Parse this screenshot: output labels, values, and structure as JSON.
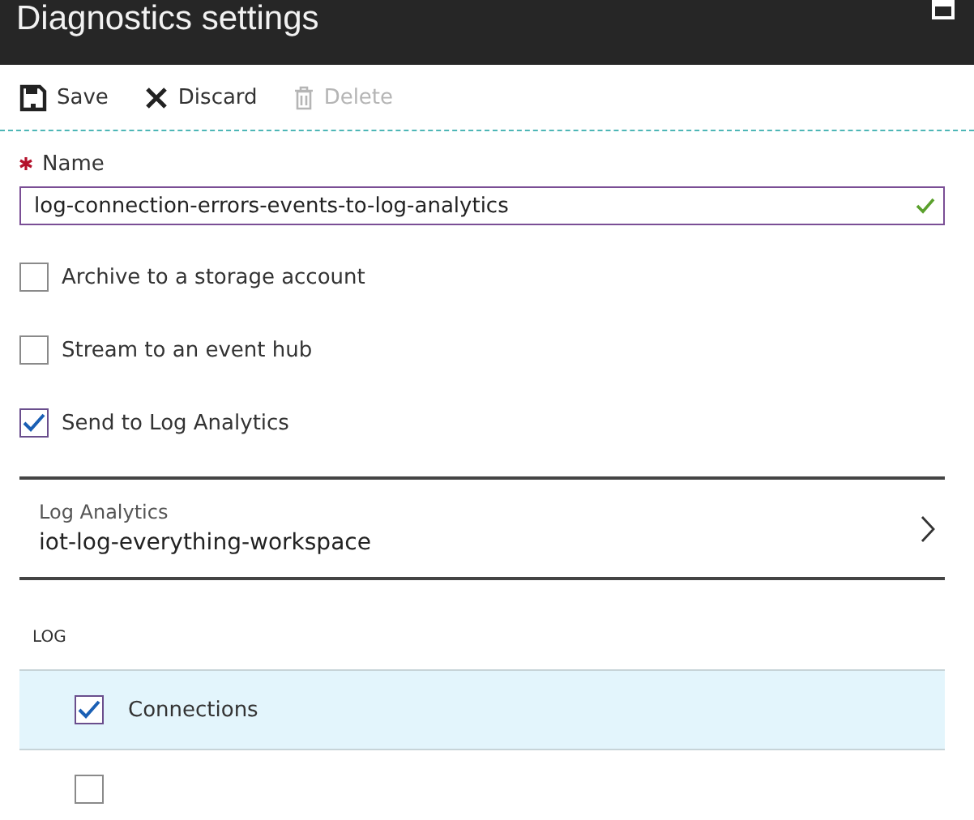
{
  "window": {
    "title": "Diagnostics settings"
  },
  "toolbar": [
    {
      "kind": "save",
      "label": "Save",
      "disabled": false
    },
    {
      "kind": "discard",
      "label": "Discard",
      "disabled": false
    },
    {
      "kind": "delete",
      "label": "Delete",
      "disabled": true
    }
  ],
  "name_field": {
    "label": "Name",
    "required": true,
    "value": "log-connection-errors-events-to-log-analytics",
    "valid": true
  },
  "destinations": [
    {
      "label": "Archive to a storage account",
      "checked": false
    },
    {
      "label": "Stream to an event hub",
      "checked": false
    },
    {
      "label": "Send to Log Analytics",
      "checked": true
    }
  ],
  "log_analytics": {
    "label": "Log Analytics",
    "value": "iot-log-everything-workspace"
  },
  "log": {
    "heading": "LOG",
    "items": [
      {
        "label": "Connections",
        "checked": true,
        "selected": true
      },
      {
        "checked": false,
        "selected": false
      }
    ]
  }
}
